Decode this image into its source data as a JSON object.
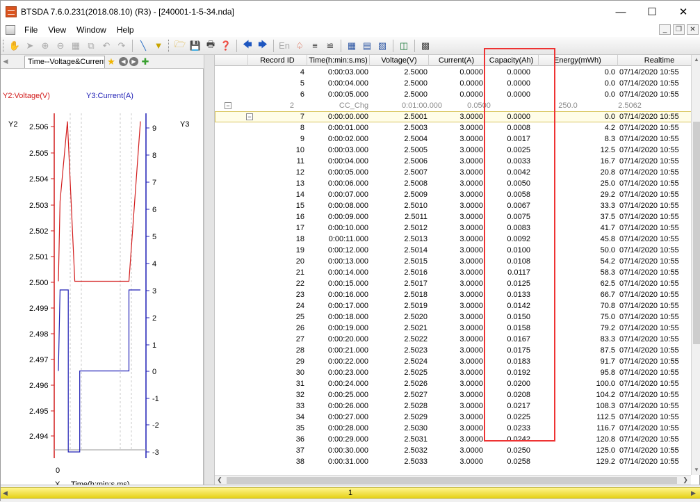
{
  "window": {
    "title": "BTSDA 7.6.0.231(2018.08.10) (R3) - [240001-1-5-34.nda]"
  },
  "menu": [
    "File",
    "View",
    "Window",
    "Help"
  ],
  "chart_panel": {
    "tab_label": "Time--Voltage&Current",
    "chart_data": {
      "type": "line",
      "y2_label": "Y2:Voltage(V)",
      "y3_label": "Y3:Current(A)",
      "y2_axis_title": "Y2",
      "y3_axis_title": "Y3",
      "x_axis_label": "X",
      "x_title": "Time(h:min:s.ms)",
      "x_tick": "0",
      "y2_ticks": [
        "2.506",
        "2.505",
        "2.504",
        "2.503",
        "2.502",
        "2.501",
        "2.500",
        "2.499",
        "2.498",
        "2.497",
        "2.496",
        "2.495",
        "2.494"
      ],
      "y3_ticks": [
        "9",
        "8",
        "7",
        "6",
        "5",
        "4",
        "3",
        "2",
        "1",
        "0",
        "-1",
        "-2",
        "-3"
      ],
      "ylim_voltage": [
        2.4935,
        2.5065
      ],
      "ylim_current": [
        -3.3,
        9.4
      ],
      "series": [
        {
          "name": "Y2:Voltage(V)",
          "color": "#d21b1b",
          "points": [
            [
              0,
              2.5
            ],
            [
              0.02,
              2.5031
            ],
            [
              0.11,
              2.5062
            ],
            [
              0.2,
              2.5
            ],
            [
              0.37,
              2.5
            ],
            [
              0.5,
              2.5
            ],
            [
              0.7,
              2.5
            ],
            [
              0.86,
              2.5
            ],
            [
              1.0,
              2.5062
            ]
          ]
        },
        {
          "name": "Y3:Current(A)",
          "color": "#1f1fb5",
          "steps": [
            [
              0,
              0
            ],
            [
              0.02,
              3.0
            ],
            [
              0.12,
              3.0
            ],
            [
              0.12,
              -3.0
            ],
            [
              0.26,
              -3.0
            ],
            [
              0.26,
              0
            ],
            [
              0.86,
              0
            ],
            [
              0.86,
              3.0
            ],
            [
              1.0,
              3.0
            ]
          ]
        }
      ]
    }
  },
  "grid": {
    "columns": [
      "Record ID",
      "Time(h:min:s.ms)",
      "Voltage(V)",
      "Current(A)",
      "Capacity(Ah)",
      "Energy(mWh)",
      "Realtime"
    ],
    "rows_before": [
      [
        "4",
        "0:00:03.000",
        "2.5000",
        "0.0000",
        "0.0000",
        "0.0",
        "07/14/2020 10:55"
      ],
      [
        "5",
        "0:00:04.000",
        "2.5000",
        "0.0000",
        "0.0000",
        "0.0",
        "07/14/2020 10:55"
      ],
      [
        "6",
        "0:00:05.000",
        "2.5000",
        "0.0000",
        "0.0000",
        "0.0",
        "07/14/2020 10:55"
      ]
    ],
    "step_row": {
      "index": "2",
      "name": "CC_Chg",
      "duration": "0:01:00.000",
      "current": "0.0500",
      "energy": "250.0",
      "voltage": "2.5062"
    },
    "rows": [
      [
        "7",
        "0:00:00.000",
        "2.5001",
        "3.0000",
        "0.0000",
        "0.0",
        "07/14/2020 10:55"
      ],
      [
        "8",
        "0:00:01.000",
        "2.5003",
        "3.0000",
        "0.0008",
        "4.2",
        "07/14/2020 10:55"
      ],
      [
        "9",
        "0:00:02.000",
        "2.5004",
        "3.0000",
        "0.0017",
        "8.3",
        "07/14/2020 10:55"
      ],
      [
        "10",
        "0:00:03.000",
        "2.5005",
        "3.0000",
        "0.0025",
        "12.5",
        "07/14/2020 10:55"
      ],
      [
        "11",
        "0:00:04.000",
        "2.5006",
        "3.0000",
        "0.0033",
        "16.7",
        "07/14/2020 10:55"
      ],
      [
        "12",
        "0:00:05.000",
        "2.5007",
        "3.0000",
        "0.0042",
        "20.8",
        "07/14/2020 10:55"
      ],
      [
        "13",
        "0:00:06.000",
        "2.5008",
        "3.0000",
        "0.0050",
        "25.0",
        "07/14/2020 10:55"
      ],
      [
        "14",
        "0:00:07.000",
        "2.5009",
        "3.0000",
        "0.0058",
        "29.2",
        "07/14/2020 10:55"
      ],
      [
        "15",
        "0:00:08.000",
        "2.5010",
        "3.0000",
        "0.0067",
        "33.3",
        "07/14/2020 10:55"
      ],
      [
        "16",
        "0:00:09.000",
        "2.5011",
        "3.0000",
        "0.0075",
        "37.5",
        "07/14/2020 10:55"
      ],
      [
        "17",
        "0:00:10.000",
        "2.5012",
        "3.0000",
        "0.0083",
        "41.7",
        "07/14/2020 10:55"
      ],
      [
        "18",
        "0:00:11.000",
        "2.5013",
        "3.0000",
        "0.0092",
        "45.8",
        "07/14/2020 10:55"
      ],
      [
        "19",
        "0:00:12.000",
        "2.5014",
        "3.0000",
        "0.0100",
        "50.0",
        "07/14/2020 10:55"
      ],
      [
        "20",
        "0:00:13.000",
        "2.5015",
        "3.0000",
        "0.0108",
        "54.2",
        "07/14/2020 10:55"
      ],
      [
        "21",
        "0:00:14.000",
        "2.5016",
        "3.0000",
        "0.0117",
        "58.3",
        "07/14/2020 10:55"
      ],
      [
        "22",
        "0:00:15.000",
        "2.5017",
        "3.0000",
        "0.0125",
        "62.5",
        "07/14/2020 10:55"
      ],
      [
        "23",
        "0:00:16.000",
        "2.5018",
        "3.0000",
        "0.0133",
        "66.7",
        "07/14/2020 10:55"
      ],
      [
        "24",
        "0:00:17.000",
        "2.5019",
        "3.0000",
        "0.0142",
        "70.8",
        "07/14/2020 10:55"
      ],
      [
        "25",
        "0:00:18.000",
        "2.5020",
        "3.0000",
        "0.0150",
        "75.0",
        "07/14/2020 10:55"
      ],
      [
        "26",
        "0:00:19.000",
        "2.5021",
        "3.0000",
        "0.0158",
        "79.2",
        "07/14/2020 10:55"
      ],
      [
        "27",
        "0:00:20.000",
        "2.5022",
        "3.0000",
        "0.0167",
        "83.3",
        "07/14/2020 10:55"
      ],
      [
        "28",
        "0:00:21.000",
        "2.5023",
        "3.0000",
        "0.0175",
        "87.5",
        "07/14/2020 10:55"
      ],
      [
        "29",
        "0:00:22.000",
        "2.5024",
        "3.0000",
        "0.0183",
        "91.7",
        "07/14/2020 10:55"
      ],
      [
        "30",
        "0:00:23.000",
        "2.5025",
        "3.0000",
        "0.0192",
        "95.8",
        "07/14/2020 10:55"
      ],
      [
        "31",
        "0:00:24.000",
        "2.5026",
        "3.0000",
        "0.0200",
        "100.0",
        "07/14/2020 10:55"
      ],
      [
        "32",
        "0:00:25.000",
        "2.5027",
        "3.0000",
        "0.0208",
        "104.2",
        "07/14/2020 10:55"
      ],
      [
        "33",
        "0:00:26.000",
        "2.5028",
        "3.0000",
        "0.0217",
        "108.3",
        "07/14/2020 10:55"
      ],
      [
        "34",
        "0:00:27.000",
        "2.5029",
        "3.0000",
        "0.0225",
        "112.5",
        "07/14/2020 10:55"
      ],
      [
        "35",
        "0:00:28.000",
        "2.5030",
        "3.0000",
        "0.0233",
        "116.7",
        "07/14/2020 10:55"
      ],
      [
        "36",
        "0:00:29.000",
        "2.5031",
        "3.0000",
        "0.0242",
        "120.8",
        "07/14/2020 10:55"
      ],
      [
        "37",
        "0:00:30.000",
        "2.5032",
        "3.0000",
        "0.0250",
        "125.0",
        "07/14/2020 10:55"
      ],
      [
        "38",
        "0:00:31.000",
        "2.5033",
        "3.0000",
        "0.0258",
        "129.2",
        "07/14/2020 10:55"
      ]
    ]
  },
  "status": {
    "page": "1"
  },
  "colors": {
    "highlight": "#e33333",
    "voltage": "#d21b1b",
    "current": "#1f1fb5"
  }
}
